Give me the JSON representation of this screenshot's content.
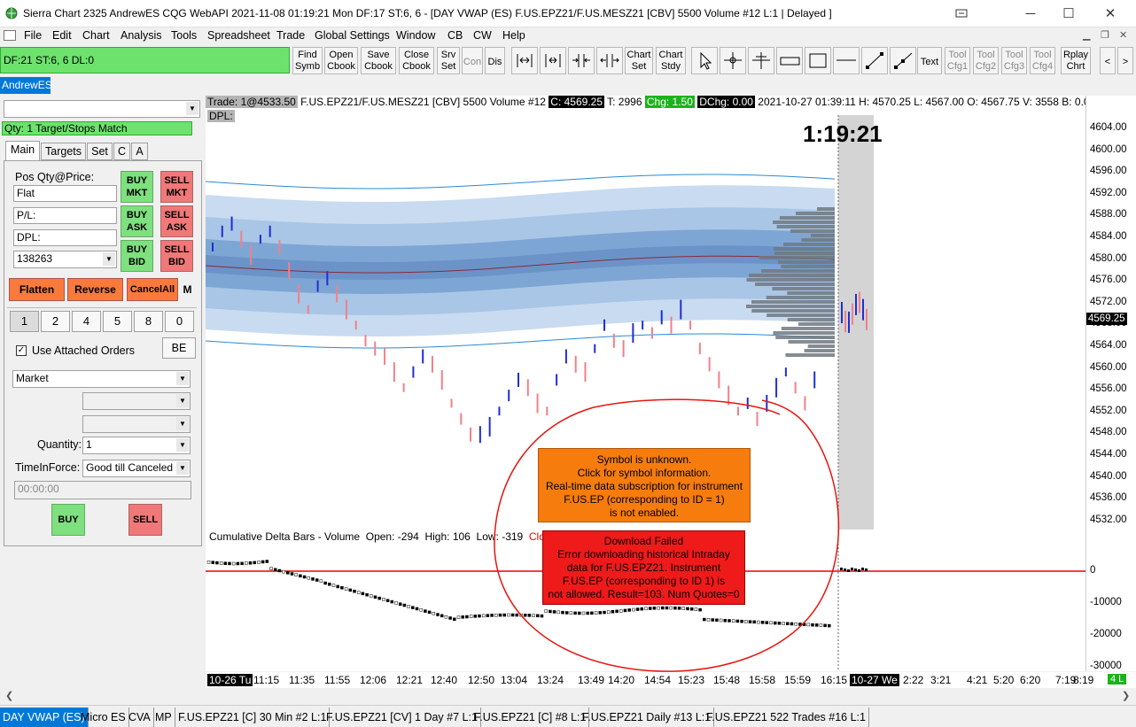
{
  "window": {
    "title": "Sierra Chart 2325 AndrewES  CQG WebAPI 2021-11-08  01:19:21 Mon  DF:17  ST:6, 6 - [DAY VWAP (ES) F.US.EPZ21/F.US.MESZ21 [CBV]  5500 Volume  #12 L:1 | Delayed ]",
    "minimize": "─",
    "maximize": "☐",
    "close": "✕"
  },
  "menu": [
    "File",
    "Edit",
    "Chart",
    "Analysis",
    "Tools",
    "Spreadsheet",
    "Trade",
    "Global Settings",
    "Window",
    "CB",
    "CW",
    "Help"
  ],
  "toolbar": {
    "status": "DF:21  ST:6, 6  DL:0",
    "buttons": [
      {
        "l1": "Find",
        "l2": "Symb"
      },
      {
        "l1": "Open",
        "l2": "Cbook"
      },
      {
        "l1": "Save",
        "l2": "Cbook"
      },
      {
        "l1": "Close",
        "l2": "Cbook"
      },
      {
        "l1": "Srv",
        "l2": "Set"
      }
    ],
    "con": "Con",
    "dis": "Dis",
    "chart_set": {
      "l1": "Chart",
      "l2": "Set"
    },
    "chart_stdy": {
      "l1": "Chart",
      "l2": "Stdy"
    },
    "text": "Text",
    "tool_cfgs": [
      {
        "l1": "Tool",
        "l2": "Cfg1"
      },
      {
        "l1": "Tool",
        "l2": "Cfg2"
      },
      {
        "l1": "Tool",
        "l2": "Cfg3"
      },
      {
        "l1": "Tool",
        "l2": "Cfg4"
      }
    ],
    "replay": {
      "l1": "Rplay",
      "l2": "Chrt"
    },
    "prev": "<",
    "next": ">"
  },
  "account_tab": "AndrewES",
  "trade_panel": {
    "qty_status": "Qty: 1 Target/Stops Match",
    "tabs": [
      "Main",
      "Targets",
      "Set",
      "C",
      "A"
    ],
    "pos_label": "Pos Qty@Price:",
    "pos_value": "Flat",
    "pl_label": "P/L:",
    "dpl_label": "DPL:",
    "account_number": "138263",
    "buy_mkt": "BUY MKT",
    "sell_mkt": "SELL MKT",
    "buy_ask": "BUY ASK",
    "sell_ask": "SELL ASK",
    "buy_bid": "BUY BID",
    "sell_bid": "SELL BID",
    "flatten": "Flatten",
    "reverse": "Reverse",
    "cancel_all": "CancelAll",
    "m": "M",
    "quantities": [
      "1",
      "2",
      "4",
      "5",
      "8",
      "0"
    ],
    "use_attached": "Use Attached Orders",
    "be": "BE",
    "order_type": "Market",
    "quantity_label": "Quantity:",
    "quantity_value": "1",
    "tif_label": "TimeInForce:",
    "tif_value": "Good till Canceled",
    "time_value": "00:00:00",
    "buy": "BUY",
    "sell": "SELL"
  },
  "chart_header": {
    "prefix": "Trade: 1@4533.50",
    "symbol": "F.US.EPZ21/F.US.MESZ21 [CBV]  5500 Volume  #12",
    "c": "C: 4569.25",
    "t": "T: 2996",
    "chg": "Chg: 1.50",
    "dchg": "DChg: 0.00",
    "rest": "2021-10-27 01:39:11  H: 4570.25  L: 4567.00  O: 4567.75  V: 3558  B: 0.00  A: 0.00  0x0 RV",
    "dpl": "DPL:"
  },
  "countdown": "1:19:21",
  "current_price": "4569.25",
  "price_ticks": [
    "4604.00",
    "4600.00",
    "4596.00",
    "4592.00",
    "4588.00",
    "4584.00",
    "4580.00",
    "4576.00",
    "4572.00",
    "4568.00",
    "4564.00",
    "4560.00",
    "4556.00",
    "4552.00",
    "4548.00",
    "4544.00",
    "4540.00",
    "4536.00",
    "4532.00"
  ],
  "delta_header": {
    "label": "Cumulative Delta Bars - Volume",
    "open": "Open: -294",
    "high": "High: 106",
    "low": "Low: -319",
    "close": "Close"
  },
  "delta_ticks": [
    "0",
    "-10000",
    "-20000",
    "-30000"
  ],
  "time_ticks": [
    "10-26 Tu",
    "11:15",
    "11:35",
    "11:55",
    "12:06",
    "12:21",
    "12:40",
    "12:50",
    "13:04",
    "13:24",
    "13:49",
    "14:20",
    "14:54",
    "15:23",
    "15:48",
    "15:58",
    "15:59",
    "16:15",
    "10-27 We",
    "2:22",
    "3:21",
    "4:21",
    "5:20",
    "6:20",
    "7:19",
    "8:19"
  ],
  "time_end_badge": "4 L",
  "messages": {
    "symbol_unknown": [
      "Symbol is unknown.",
      "Click for symbol information.",
      "Real-time data subscription for instrument",
      "F.US.EP (corresponding to ID = 1)",
      "is not enabled."
    ],
    "download_failed": [
      "Download Failed",
      "Error downloading historical Intraday",
      "data for F.US.EPZ21.  Instrument",
      "F.US.EP (corresponding to ID 1) is",
      "not allowed. Result=103. Num Quotes=0"
    ]
  },
  "bottom_tabs": [
    "DAY VWAP (ES)",
    "Micro ES",
    "CVA",
    "MP",
    "F.US.EPZ21 [C]  30 Min  #2 L:1",
    "F.US.EPZ21 [CV]  1 Day  #7 L:1",
    "F.US.EPZ21 [C]  #8 L:1",
    "F.US.EPZ21  Daily  #13 L:1",
    "F.US.EPZ21  522 Trades  #16 L:1"
  ],
  "chart_data": {
    "type": "ohlc",
    "ylim": [
      4530,
      4606
    ],
    "bars_approx_close": [
      4586,
      4588,
      4589,
      4587,
      4585,
      4587,
      4588,
      4586,
      4583,
      4580,
      4578,
      4581,
      4582,
      4580,
      4578,
      4576,
      4574,
      4573,
      4572,
      4570,
      4568,
      4570,
      4572,
      4571,
      4569,
      4566,
      4564,
      4562,
      4562,
      4563,
      4565,
      4567,
      4569,
      4568,
      4566,
      4565,
      4569,
      4572,
      4571,
      4570,
      4573,
      4576,
      4574,
      4573,
      4575,
      4576,
      4575,
      4577,
      4576,
      4578,
      4576,
      4573,
      4571,
      4569,
      4567,
      4565,
      4566,
      4564,
      4566,
      4568,
      4570,
      4568,
      4566,
      4569
    ],
    "delta_ylim": [
      -30000,
      5000
    ]
  }
}
